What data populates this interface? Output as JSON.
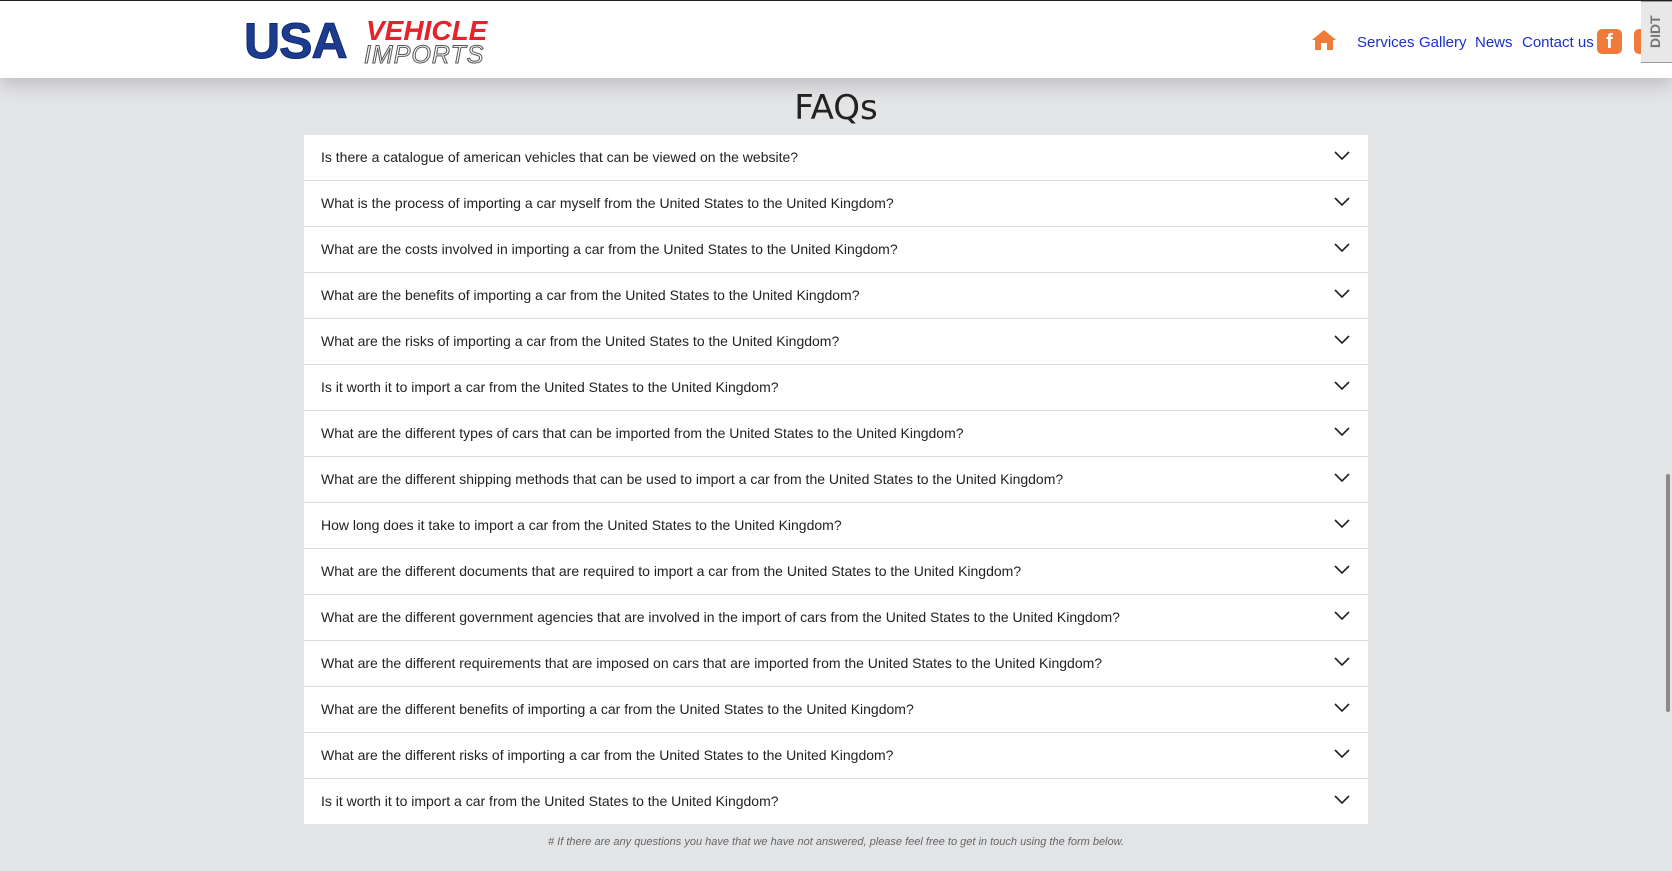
{
  "header": {
    "logo": {
      "usa": "USA",
      "vehicle": "VEHICLE",
      "imports": "IMPORTS"
    },
    "nav": {
      "home_icon": "home-icon",
      "links": [
        "Services",
        "Gallery",
        "News",
        "Contact us"
      ],
      "social": [
        "facebook-icon",
        "youtube-icon"
      ]
    },
    "extension_tab": "DIDT"
  },
  "page_title": "FAQs",
  "faqs": [
    "Is there a catalogue of american vehicles that can be viewed on the website?",
    "What is the process of importing a car myself from the United States to the United Kingdom?",
    "What are the costs involved in importing a car from the United States to the United Kingdom?",
    "What are the benefits of importing a car from the United States to the United Kingdom?",
    "What are the risks of importing a car from the United States to the United Kingdom?",
    "Is it worth it to import a car from the United States to the United Kingdom?",
    "What are the different types of cars that can be imported from the United States to the United Kingdom?",
    "What are the different shipping methods that can be used to import a car from the United States to the United Kingdom?",
    "How long does it take to import a car from the United States to the United Kingdom?",
    "What are the different documents that are required to import a car from the United States to the United Kingdom?",
    "What are the different government agencies that are involved in the import of cars from the United States to the United Kingdom?",
    "What are the different requirements that are imposed on cars that are imported from the United States to the United Kingdom?",
    "What are the different benefits of importing a car from the United States to the United Kingdom?",
    "What are the different risks of importing a car from the United States to the United Kingdom?",
    "Is it worth it to import a car from the United States to the United Kingdom?"
  ],
  "footnote": "# If there are any questions you have that we have not answered, please feel free to get in touch using the form below.",
  "colors": {
    "nav_link": "#1a30c8",
    "accent_orange": "#f07a3a",
    "logo_blue": "#1d3c8f",
    "logo_red": "#e4232b",
    "page_bg": "#e3e4e6"
  }
}
